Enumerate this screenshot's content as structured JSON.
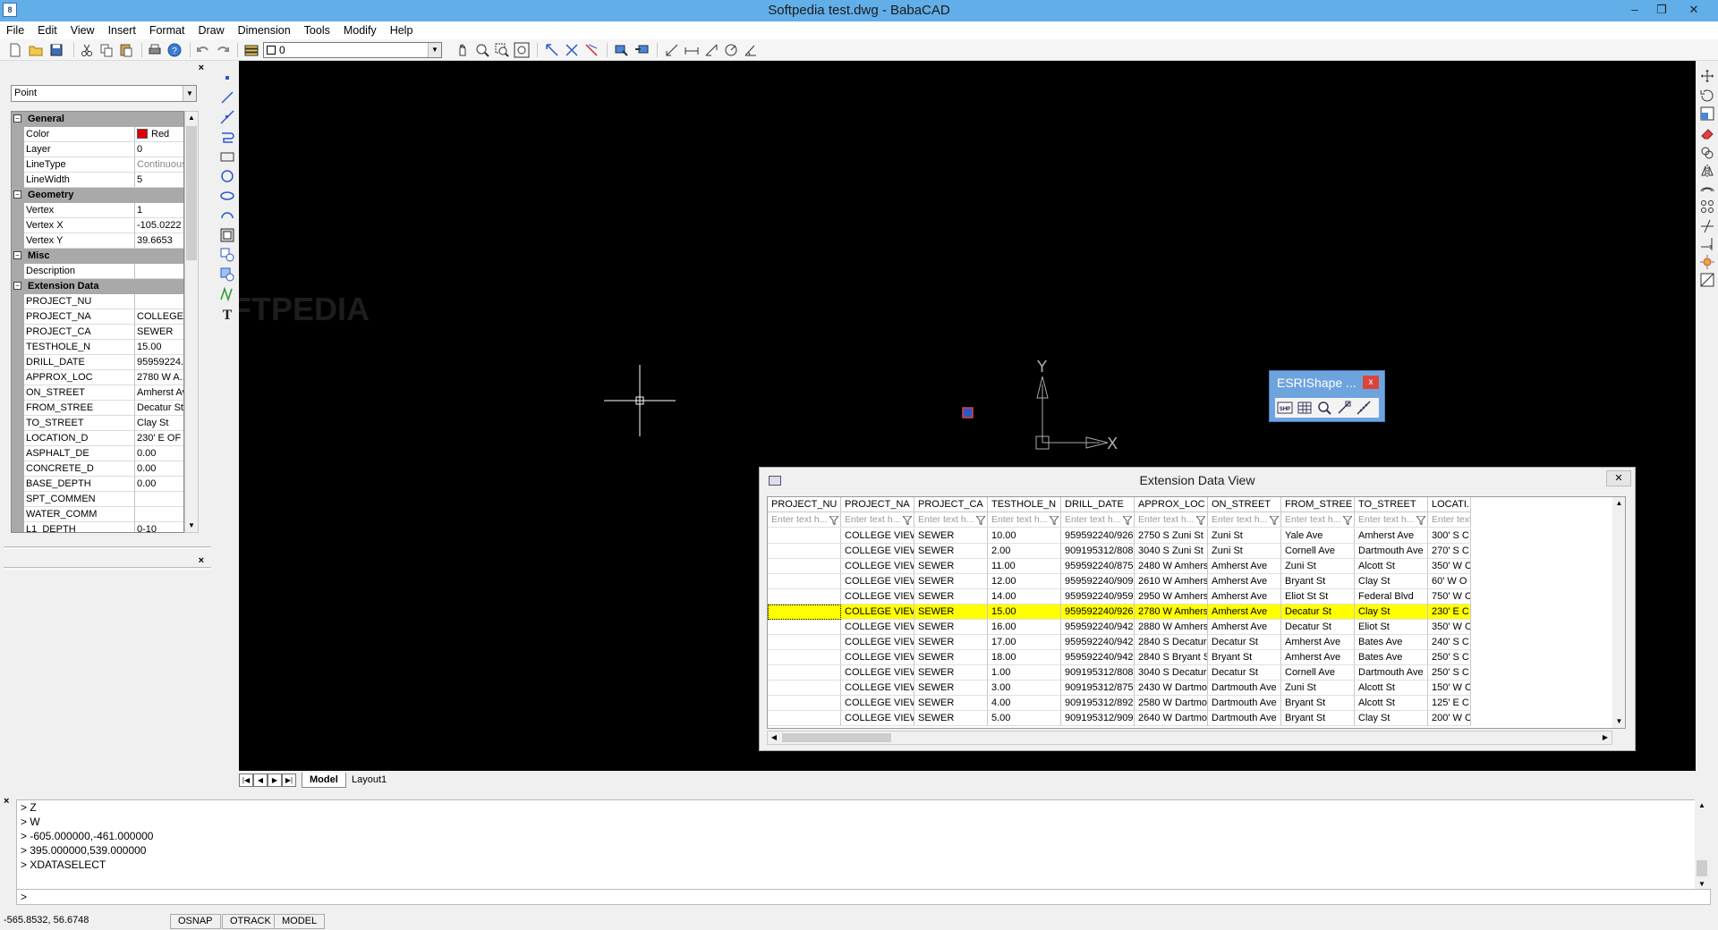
{
  "window": {
    "title": "Softpedia test.dwg - BabaCAD",
    "app_icon_text": "8",
    "minimize": "–",
    "maximize": "❒",
    "close": "✕"
  },
  "menu": [
    "File",
    "Edit",
    "View",
    "Insert",
    "Format",
    "Draw",
    "Dimension",
    "Tools",
    "Modify",
    "Help"
  ],
  "toolbar": {
    "layer_value": "0",
    "icons": [
      "new-icon",
      "open-icon",
      "save-icon",
      "cut-icon",
      "copy-icon",
      "paste-icon",
      "print-icon",
      "help-icon",
      "undo-icon",
      "redo-icon",
      "layers-icon",
      "pan-icon",
      "zoom-realtime-icon",
      "zoom-window-icon",
      "zoom-extents-icon",
      "snap-icon-1",
      "snap-icon-2",
      "snap-icon-3",
      "block-icon",
      "insert-icon",
      "dim-icon-1",
      "dim-icon-2",
      "dim-icon-3",
      "dim-icon-4",
      "dim-icon-5"
    ]
  },
  "properties": {
    "close": "×",
    "entity_type": "Point",
    "sections": [
      {
        "title": "General",
        "rows": [
          {
            "name": "Color",
            "value": "Red",
            "swatch": true
          },
          {
            "name": "Layer",
            "value": "0"
          },
          {
            "name": "LineType",
            "value": "Continuous",
            "dim": true
          },
          {
            "name": "LineWidth",
            "value": "5"
          }
        ]
      },
      {
        "title": "Geometry",
        "rows": [
          {
            "name": "Vertex",
            "value": "1"
          },
          {
            "name": "Vertex X",
            "value": "-105.0222"
          },
          {
            "name": "Vertex Y",
            "value": "39.6653"
          }
        ]
      },
      {
        "title": "Misc",
        "rows": [
          {
            "name": "Description",
            "value": ""
          }
        ]
      },
      {
        "title": "Extension Data",
        "rows": [
          {
            "name": "PROJECT_NU",
            "value": ""
          },
          {
            "name": "PROJECT_NA",
            "value": "COLLEGE V..."
          },
          {
            "name": "PROJECT_CA",
            "value": "SEWER"
          },
          {
            "name": "TESTHOLE_N",
            "value": "15.00"
          },
          {
            "name": "DRILL_DATE",
            "value": "95959224..."
          },
          {
            "name": "APPROX_LOC",
            "value": "2780 W A..."
          },
          {
            "name": "ON_STREET",
            "value": "Amherst Ave"
          },
          {
            "name": "FROM_STREE",
            "value": "Decatur St"
          },
          {
            "name": "TO_STREET",
            "value": "Clay St"
          },
          {
            "name": "LOCATION_D",
            "value": "230' E OF ..."
          },
          {
            "name": "ASPHALT_DE",
            "value": "0.00"
          },
          {
            "name": "CONCRETE_D",
            "value": "0.00"
          },
          {
            "name": "BASE_DEPTH",
            "value": "0.00"
          },
          {
            "name": "SPT_COMMEN",
            "value": ""
          },
          {
            "name": "WATER_COMM",
            "value": ""
          },
          {
            "name": "L1_DEPTH",
            "value": "0-10"
          }
        ]
      }
    ]
  },
  "canvas": {
    "ucs_y": "Y",
    "ucs_x": "X",
    "watermark": "SOFTPEDIA"
  },
  "layout_tabs": {
    "nav": [
      "|◀",
      "◀",
      "▶",
      "▶|"
    ],
    "tabs": [
      "Model",
      "Layout1"
    ]
  },
  "esri_toolbar": {
    "title": "ESRIShape ...",
    "close": "x",
    "icons": [
      "shp-icon",
      "table-icon",
      "zoom-icon",
      "select-icon",
      "measure-icon"
    ]
  },
  "extension_view": {
    "title": "Extension Data View",
    "close": "✕",
    "columns": [
      "PROJECT_NU",
      "PROJECT_NA",
      "PROJECT_CA",
      "TESTHOLE_N",
      "DRILL_DATE",
      "APPROX_LOC",
      "ON_STREET",
      "FROM_STREE",
      "TO_STREET",
      "LOCATI..."
    ],
    "filter_placeholder": "Enter text h...",
    "selected_row": 5,
    "rows": [
      [
        "",
        "COLLEGE VIEW ...",
        "SEWER",
        "10.00",
        "959592240/926...",
        "2750 S Zuni St",
        "Zuni St",
        "Yale Ave",
        "Amherst Ave",
        "300' S C"
      ],
      [
        "",
        "COLLEGE VIEW ...",
        "SEWER",
        "2.00",
        "909195312/808...",
        "3040 S Zuni St",
        "Zuni St",
        "Cornell Ave",
        "Dartmouth Ave",
        "270' S C"
      ],
      [
        "",
        "COLLEGE VIEW ...",
        "SEWER",
        "11.00",
        "959592240/875...",
        "2480 W Amhers...",
        "Amherst Ave",
        "Zuni St",
        "Alcott St",
        "350' W C"
      ],
      [
        "",
        "COLLEGE VIEW ...",
        "SEWER",
        "12.00",
        "959592240/909...",
        "2610 W Amhers...",
        "Amherst Ave",
        "Bryant St",
        "Clay St",
        "60' W O"
      ],
      [
        "",
        "COLLEGE VIEW ...",
        "SEWER",
        "14.00",
        "959592240/959...",
        "2950 W Amhers...",
        "Amherst Ave",
        "Eliot St St",
        "Federal Blvd",
        "750' W C"
      ],
      [
        "",
        "COLLEGE VIEW ...",
        "SEWER",
        "15.00",
        "959592240/926...",
        "2780 W Amhers...",
        "Amherst Ave",
        "Decatur St",
        "Clay St",
        "230' E C"
      ],
      [
        "",
        "COLLEGE VIEW ...",
        "SEWER",
        "16.00",
        "959592240/942...",
        "2880 W Amhers...",
        "Amherst Ave",
        "Decatur St",
        "Eliot St",
        "350' W C"
      ],
      [
        "",
        "COLLEGE VIEW ...",
        "SEWER",
        "17.00",
        "959592240/942...",
        "2840 S Decatur St",
        "Decatur St",
        "Amherst Ave",
        "Bates Ave",
        "240' S C"
      ],
      [
        "",
        "COLLEGE VIEW ...",
        "SEWER",
        "18.00",
        "959592240/942...",
        "2840 S Bryant St",
        "Bryant St",
        "Amherst Ave",
        "Bates Ave",
        "250' S C"
      ],
      [
        "",
        "COLLEGE VIEW ...",
        "SEWER",
        "1.00",
        "909195312/808...",
        "3040 S Decatur St",
        "Decatur St",
        "Cornell Ave",
        "Dartmouth Ave",
        "250' S C"
      ],
      [
        "",
        "COLLEGE VIEW ...",
        "SEWER",
        "3.00",
        "909195312/875...",
        "2430 W Dartmo...",
        "Dartmouth Ave",
        "Zuni St",
        "Alcott St",
        "150' W C"
      ],
      [
        "",
        "COLLEGE VIEW ...",
        "SEWER",
        "4.00",
        "909195312/892...",
        "2580 W Dartmo...",
        "Dartmouth Ave",
        "Bryant St",
        "Alcott St",
        "125' E C"
      ],
      [
        "",
        "COLLEGE VIEW ...",
        "SEWER",
        "5.00",
        "909195312/909...",
        "2640 W Dartmo...",
        "Dartmouth Ave",
        "Bryant St",
        "Clay St",
        "200' W C"
      ]
    ]
  },
  "command": {
    "close": "×",
    "history": [
      "> Z",
      "> W",
      "> -605.000000,-461.000000",
      "> 395.000000,539.000000",
      "> XDATASELECT"
    ],
    "prompt": ">"
  },
  "status": {
    "coords": "-565.8532, 56.6748",
    "buttons": [
      "OSNAP",
      "OTRACK",
      "MODEL"
    ]
  }
}
